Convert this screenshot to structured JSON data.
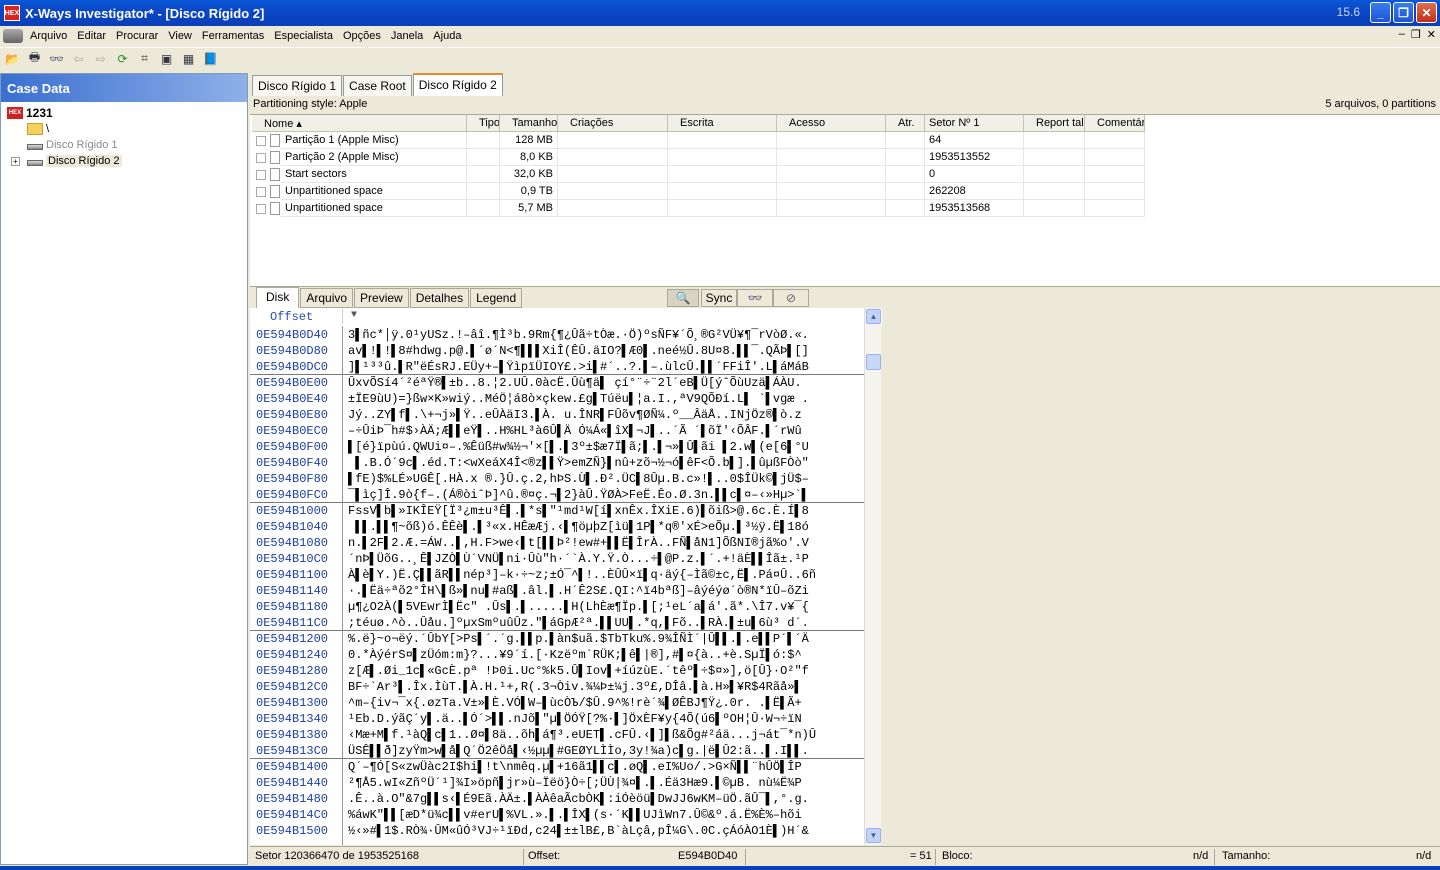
{
  "window": {
    "title": "X-Ways Investigator* - [Disco Rígido 2]",
    "icon_text": "HEX",
    "version": "15.6",
    "minimize": "_",
    "maximize": "❐",
    "close": "✕"
  },
  "menu": {
    "items": [
      "Arquivo",
      "Editar",
      "Procurar",
      "View",
      "Ferramentas",
      "Especialista",
      "Opções",
      "Janela",
      "Ajuda"
    ],
    "mdi": [
      "–",
      "❐",
      "✕"
    ]
  },
  "toolbar": {
    "icons": [
      "open-icon",
      "print-icon",
      "find-icon",
      "back-icon",
      "forward-icon",
      "refresh-icon",
      "hash-icon",
      "camera-icon",
      "grid-icon",
      "book-icon"
    ],
    "glyphs": [
      "📂",
      "🖶",
      "👓",
      "⇦",
      "⇨",
      "⟳",
      "⌗",
      "▣",
      "▦",
      "📘"
    ]
  },
  "case_panel": {
    "header": "Case Data",
    "root": "1231",
    "folder": "\\",
    "disk1": "Disco Rígido 1",
    "disk2": "Disco Rígido 2",
    "expand": "+"
  },
  "tabs": [
    "Disco Rígido 1",
    "Case Root",
    "Disco Rígido 2"
  ],
  "info": {
    "left": "Partitioning style: Apple",
    "right": "5 arquivos, 0 partitions"
  },
  "columns": [
    "Nome",
    "Tipo",
    "Tamanho",
    "Criações",
    "Escrita",
    "Acesso",
    "Atr.",
    "Setor Nº 1",
    "Report tal",
    "Comentário"
  ],
  "rows": [
    {
      "name": "Partição 1 (Apple Misc)",
      "size": "128 MB",
      "sector": "64"
    },
    {
      "name": "Partição 2 (Apple Misc)",
      "size": "8,0 KB",
      "sector": "1953513552"
    },
    {
      "name": "Start sectors",
      "size": "32,0 KB",
      "sector": "0"
    },
    {
      "name": "Unpartitioned space",
      "size": "0,9 TB",
      "sector": "262208"
    },
    {
      "name": "Unpartitioned space",
      "size": "5,7 MB",
      "sector": "1953513568"
    }
  ],
  "view_tabs": [
    "Disk",
    "Arquivo",
    "Preview",
    "Detalhes",
    "Legend"
  ],
  "view_tools": {
    "sync": "Sync"
  },
  "hex": {
    "offset_label": "Offset",
    "rows": [
      {
        "off": "0E594B0D40",
        "txt": "3▌ñc*│ÿ.0¹yUSz.!–âî.¶Ì³b.9Rm{¶¿Ûã÷tÒæ.·Ö)ºsÑF¥´Õ¸®G²VÜ¥¶¯rVòØ.«."
      },
      {
        "off": "0E594B0D80",
        "txt": "av▌!▌!▌8#hdwg.p@.▌´ø´N<¶▌▌▌XiÎ(ÊÛ.äΙO?▌Æ0▌.neé½Û.8U¤8.▌▌¯.QÃÞ▌[]"
      },
      {
        "off": "0E594B0DC0",
        "txt": "]▌¹³³û.▌R\"ëÉsRJ.EÜy+–▌ŸìpïÜIOY£.>i▌#´..?.▌–.ùlcÛ.▌▌´FFiÎ'.L▌áMáB"
      },
      {
        "off": "0E594B0E00",
        "txt": "ÛxvÕSí4´²éªŸ®▌±b..8.¦2.UÛ.0àcË.Ûù¶ä▌ çí°¨÷¨2l´eB▌Ü[ýˆÕùUzä▌ÁÀU."
      },
      {
        "off": "0E594B0E40",
        "txt": "±ÏE9ùU)=}ßw×K»wiý..MéÖ¦á8ò×çkew.£g▌Túëu▌¦a.I.,ªV9QÕÐí.L▌ `▌vgæ ."
      },
      {
        "off": "0E594B0E80",
        "txt": "Jý..ZY▌f▌.\\+¬j»▌Ÿ..eÛÀäI3.▌À. u.ÎNR▌FÛõv¶ØÑ¼.º__ÂäÅ..INjÖz®▌ò.z"
      },
      {
        "off": "0E594B0EC0",
        "txt": "–÷ÛiÞ¯h#$›ÀÄ;Æ▌▌eŸ▌..H%HL³à6Û▌Ä Ó¼Á«▌îX▌¬J▌..´Ã ´▌õÏ'‹ÕÂF.▌´rWû"
      },
      {
        "off": "0E594B0F00",
        "txt": "▌[é}ïpùú.QWUi¤–.%Êüß#w¾½¬'×[▌.▌3º±$æ7Ï▌ã;▌.▌¬»▌Û▌ãi ▌2.w▌(e[6▌°U"
      },
      {
        "off": "0E594B0F40",
        "txt": " ▌.B.Ó´9c▌.éd.T:<wXeáX4Î<®z▌▌Ÿ>emZÑ}▌nû+zõ¬½¬ó▌êF<Õ.b▌].▌ûµßFÒò\""
      },
      {
        "off": "0E594B0F80",
        "txt": "▌fE)$%LÉ»UGÊ[.HÀ.x ®.}Û.ç.2,hÞS.Ù▌.Ð².ÜC▌8Ûµ.B.c»!▌..0$ÎÜk©▌jÜ$–"
      },
      {
        "off": "0E594B0FC0",
        "txt": "¯▌ìç]Î.9ò{f–.(Á®òiˆÞ]^û.®¤ç.¬▌2}àÛ.ŸØÀ>FeË.Êo.Ø.3n.▌▌c▌¤–‹»Hµ>`▌"
      },
      {
        "off": "0E594B1000",
        "txt": "FssV▌b▌»IKÎEŸ[Ï³¿m±u³Ê▌.▌*s▌\"¹md¹W[í▌xnÊx.ÎXiE.6)▌õiß>@.6c.È.Í▌8"
      },
      {
        "off": "0E594B1040",
        "txt": " ▌▌.▌▌¶~õß)ó.ÊÊè▌.▌³«x.HÊæÆj.‹▌¶öµþZ[ìü▌1P▌*q®'xÉ>eÕµ.▌³½ÿ.Ë▌18ó"
      },
      {
        "off": "0E594B1080",
        "txt": "n.▌2F▌2.Æ.=ÁW..▌,H.F>we‹▌t[▌▌Þ²!ew#+▌▌Ë▌ÎrÀ..FÑ▌åN1]ÕßNI®jã%o'.V"
      },
      {
        "off": "0E594B10C0",
        "txt": "´nÞ▌ÜõG..¸Ê▌JZÒ▌Ù´VNÜ▌ni·Ûù\"h·´`À.Y.Ÿ.Ò...÷▌@P.z.▌´.+!äÈ▌▌Îã±.¹P"
      },
      {
        "off": "0E594B1100",
        "txt": "À▌è▌Y.)Ë.Ç▌▌ãR▌▌nép³]–k·÷~z;±Ó¯^▌!..ÈÛÛ×ï▌q·äý{–Ìã©±c,Ë▌.Pá¤Û..6ñ"
      },
      {
        "off": "0E594B1140",
        "txt": "·.▌Ëä÷ªõ2°ÎH\\▌ß»▌nu▌#aß▌.âl.▌.H´Ê2S£.QI:^ï4bªß]–âýéýø´ò®N*ïÛ–õZi"
      },
      {
        "off": "0E594B1180",
        "txt": "µ¶¿O2À(▌5VEwrÌ▌Ëc\" .Ûs▌.▌.....▌H(LhÈæ¶Ïp.▌[;¹eL´a▌á'.ã*.\\Î7.v¥¯{"
      },
      {
        "off": "0E594B11C0",
        "txt": ";téuø.^ò..Ûåu.]ºµxSmºuûÛz.\"▌áGpÆ²ª.▌▌UU▌.*q,▌Fõ..▌RÀ.▌±u▌6ù³ d´."
      },
      {
        "off": "0E594B1200",
        "txt": "%.ë}~o¬ëý.´ÛbY[>Ps▌´.´g.▌▌p.▌àn$uã.$TbTku%.9¾ÎÑÌ´|Û▌▌.▌.e▌▌P´▌´Ä"
      },
      {
        "off": "0E594B1240",
        "txt": "0.*ÀýérS¤▌zÜóm:m}?...¥9´í.[·Kzëºm`RÜK;▌ê▌|®],#▌¤{à..+è.SµÏ▌ó:$^"
      },
      {
        "off": "0E594B1280",
        "txt": "z[Æ▌.Øi_1c▌«GcÈ.pª !Þ0i.Uc°%k5.Û▌Iov▌+íúzùE.´têº▌÷$¤»],ö[Û}·O²\"f"
      },
      {
        "off": "0E594B12C0",
        "txt": "BF÷`Ar³▌.Îx.ÌùT.▌À.H.¹+,R(.3¬Òiv.¾¼Þ±¼j.3º£,DÎâ.▌à.H»▌¥R$4Rãå»▌"
      },
      {
        "off": "0E594B1300",
        "txt": "^m–{iv¬¯x{.øzTa.V±»▌È.VÓ▌W–▌ùcÒЪ/$Û.9^%!rè´¾▌ØÊBJ¶Ÿ¿.0r. .▌Ë▌Ã+"
      },
      {
        "off": "0E594B1340",
        "txt": "¹Eb.D.ýãÇ´y▌.ä..▌Ó´>▌▌.nJõ▌\"µ▌ÖÓŸ[?%·▌]ÖxÈF¥y{4Õ(ú6▌ºOH¦Û·W¬÷ïN"
      },
      {
        "off": "0E594B1380",
        "txt": "‹Mæ+M▌f.¹àQ▌c▌1..Ø¤▌8ä..õh▌á¶³.eUET▌.cFÛ.‹▌]▌ß&Õg#²áä...j¬át¯*n)Û"
      },
      {
        "off": "0E594B13C0",
        "txt": "ÜSÊ▌▌ð]zyŸm>w▌å▌Q´Ö2êÖå▌‹½µµ▌#GEØYLÌÌo,3y!¾a)c▌g.|ë▌Û2:ã..▌.I▌▌."
      },
      {
        "off": "0E594B1400",
        "txt": "Q´–¶Ó[S«zwÜàc2I$hi▌!t\\nmêq.µ▌+16ã1▌▌c▌.øQ▌.eI%Uo/.>G×Ñ▌▌¨hÛÖ▌ÎP"
      },
      {
        "off": "0E594B1440",
        "txt": "²¶Å5.wI«ZñºÜ´¹]¾I»öpñ▌jr»ù–Ïëö}Ò÷[;ÜÙ|¾¤▌.▌.Éä3Hæ9.▌©µB. nù¼Ë¾P"
      },
      {
        "off": "0E594B1480",
        "txt": ".Ê..à.O\"&7g▌▌s‹▌É9Eã.ÀÄ±.▌ÀÀêaÃcbÒK▌:iÓèöü▌DwJJ6wKM–üÖ.ãÛ¯▌,°.g."
      },
      {
        "off": "0E594B14C0",
        "txt": "%áwK\"▌▌[æD*ü¾c▌▌v#erU▌%VL.».▌.▌ÎX▌(s·´K▌▌UJìWn7.Û©&º.á.Ë%È%–hõi"
      },
      {
        "off": "0E594B1500",
        "txt": "½‹»#▌1$.RÒ¾·ÛM«ûÓ³VJ÷¹ïÐd,c24▌±±lB£,B`àLçâ,pÎ¼G\\.0C.çÁóÀO1È▌)H´&"
      }
    ]
  },
  "status": {
    "sector": "Setor 120366470 de 1953525168",
    "offset_label": "Offset:",
    "offset_value": "E594B0D40",
    "eq": "= 51",
    "block_label": "Bloco:",
    "block_value": "n/d",
    "size_label": "Tamanho:",
    "size_value": "n/d"
  }
}
